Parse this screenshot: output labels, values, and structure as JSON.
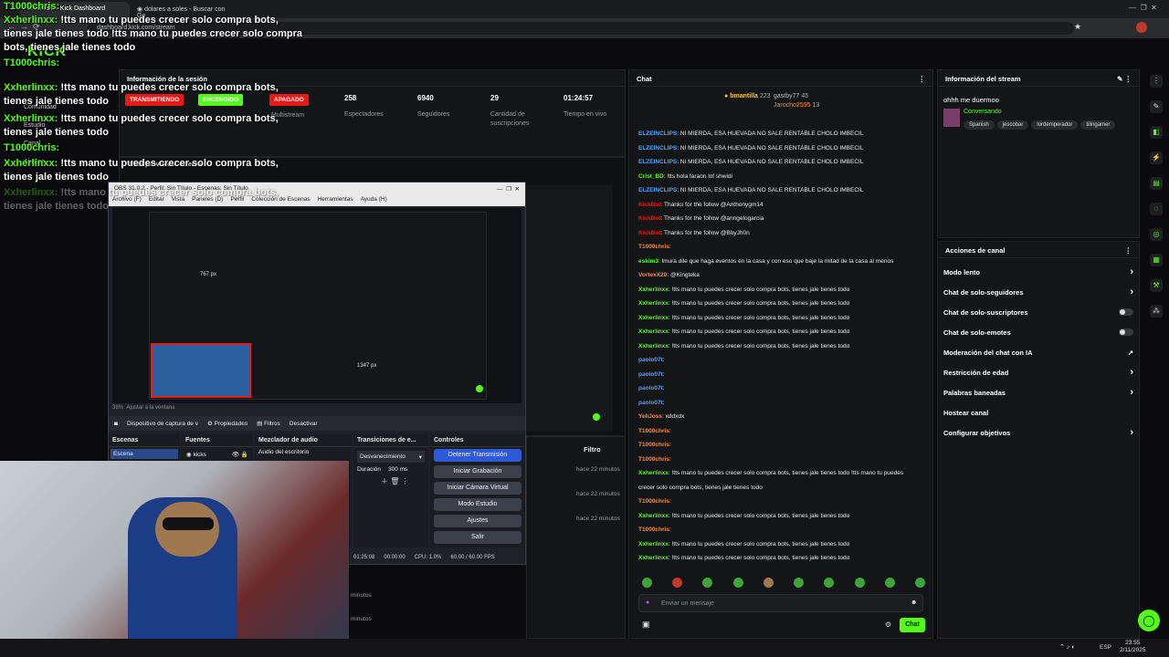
{
  "browser": {
    "tabs": [
      {
        "label": "Stream - Kick Dashboard"
      },
      {
        "label": "dolares a soles - Buscar con Go"
      }
    ],
    "url": "dashboard.kick.com/stream"
  },
  "colors": {
    "accent": "#53fc18",
    "live": "#e91916",
    "bg": "#0b0b0d",
    "panel": "#141517"
  },
  "kick": {
    "logo": "KICK"
  },
  "overlay": {
    "lines": [
      {
        "user": "T1000chris:",
        "text": ""
      },
      {
        "user": "Xxherlinxx:",
        "text": "!tts mano tu puedes crecer solo compra bots, tienes jale tienes todo !tts mano tu puedes crecer solo compra bots, tienes jale tienes todo"
      },
      {
        "user": "T1000chris:",
        "text": ""
      },
      {
        "user": "Xxherlinxx:",
        "text": "!tts mano tu puedes crecer solo compra bots, tienes jale tienes todo"
      },
      {
        "user": "Xxherlinxx:",
        "text": "!tts mano tu puedes crecer solo compra bots, tienes jale tienes todo"
      },
      {
        "user": "T1000chris:",
        "text": ""
      },
      {
        "user": "Xxherlinxx:",
        "text": "!tts mano tu puedes crecer solo compra bots, tienes jale tienes todo"
      },
      {
        "user": "Xxherlinxx:",
        "text": "!tts mano tu puedes crecer solo compra bots, tienes jale tienes todo"
      }
    ]
  },
  "sidebar": {
    "items": [
      "Stream",
      "Comunidad",
      "Estudio",
      "Canal",
      "Ajustes"
    ]
  },
  "session": {
    "title": "Información de la sesión",
    "badges": [
      "TRANSMITIENDO",
      "ENCENDIDO",
      "APAGADO"
    ],
    "multistream": "Multistream",
    "stats": [
      {
        "value": "258",
        "label": "Espectadores"
      },
      {
        "value": "6940",
        "label": "Seguidores"
      },
      {
        "value": "29",
        "label": "Cantidad de suscripciones"
      },
      {
        "value": "01:24:57",
        "label": "Tiempo en vivo"
      }
    ]
  },
  "preview": {
    "title": "Vista previa del stream"
  },
  "obs": {
    "title": "OBS 31.0.2 - Perfil: Sin Título - Escenas: Sin Título",
    "menu": [
      "Archivo (F)",
      "Editar",
      "Vista",
      "Paneles (D)",
      "Perfil",
      "Colección de Escenas",
      "Herramientas",
      "Ayuda (H)"
    ],
    "source_label": "Dispositivo de captura de v",
    "source_buttons": [
      "Propiedades",
      "Filtros",
      "Desactivar"
    ],
    "docks": [
      "Escenas",
      "Fuentes",
      "Mezclador de audio",
      "Transiciones de e...",
      "Controles"
    ],
    "scene": "Escena",
    "source": "kicks",
    "audio": "Audio del escritorio",
    "transition": "Desvanecimiento",
    "duration_label": "Duración",
    "duration_value": "300 ms",
    "controls": [
      "Detener Transmisión",
      "Iniciar Grabación",
      "Iniciar Cámara Virtual",
      "Modo Estudio",
      "Ajustes",
      "Salir"
    ],
    "status": {
      "time": "01:25:08",
      "rec": "00:00:00",
      "cpu": "CPU: 1.0%",
      "fps": "60.00 / 60.00 FPS"
    },
    "zoom": "38%",
    "fit": "Ajustar a la ventana",
    "dim1": "767 px",
    "dim2": "1347 px"
  },
  "activity": {
    "filter": "Filtro",
    "times": [
      "hace 22 minutos",
      "hace 22 minutos",
      "hace 22 minutos"
    ],
    "tail": [
      "minutos",
      "minutos",
      "minutos"
    ]
  },
  "chat": {
    "title": "Chat",
    "leaders": [
      {
        "name": "bmantilla",
        "count": "223"
      },
      {
        "name": "gastby77",
        "count": "45"
      },
      {
        "name": "Jarocho2595",
        "count": "13"
      }
    ],
    "messages": [
      {
        "user": "ELZEINCLIPS",
        "color": "#4aa3ff",
        "text": ": NI MIERDA, ESA HUEVADA NO SALE RENTABLE CHOLO IMBECIL"
      },
      {
        "user": "ELZEINCLIPS",
        "color": "#4aa3ff",
        "text": ": NI MIERDA, ESA HUEVADA NO SALE RENTABLE CHOLO IMBECIL"
      },
      {
        "user": "ELZEINCLIPS",
        "color": "#4aa3ff",
        "text": ": NI MIERDA, ESA HUEVADA NO SALE RENTABLE CHOLO IMBECIL"
      },
      {
        "user": "Crist_BD",
        "color": "#53fc18",
        "text": ": !tts hola faraon lof shwidi"
      },
      {
        "user": "ELZEINCLIPS",
        "color": "#4aa3ff",
        "text": ": NI MIERDA, ESA HUEVADA NO SALE RENTABLE CHOLO IMBECIL"
      },
      {
        "user": "KickBot",
        "color": "#e91916",
        "text": ": Thanks for the follow @Anthonygm14"
      },
      {
        "user": "KickBot",
        "color": "#e91916",
        "text": ": Thanks for the follow @anngelogarcia"
      },
      {
        "user": "KickBot",
        "color": "#e91916",
        "text": ": Thanks for the follow @BbyJh0n"
      },
      {
        "user": "T1000chris",
        "color": "#ff8a3d",
        "text": ":"
      },
      {
        "user": "eskim3",
        "color": "#53fc18",
        "text": ": lmura dile que haga eventos en la casa y con eso que baje la mitad de la casa al menos"
      },
      {
        "user": "VortexX20",
        "color": "#ff8a3d",
        "text": ": @Kingteka"
      },
      {
        "user": "Xxherlinxx",
        "color": "#53fc18",
        "text": ": !tts mano tu puedes crecer solo compra bots, tienes jale tienes todo"
      },
      {
        "user": "Xxherlinxx",
        "color": "#53fc18",
        "text": ": !tts mano tu puedes crecer solo compra bots, tienes jale tienes todo"
      },
      {
        "user": "Xxherlinxx",
        "color": "#53fc18",
        "text": ": !tts mano tu puedes crecer solo compra bots, tienes jale tienes todo"
      },
      {
        "user": "Xxherlinxx",
        "color": "#53fc18",
        "text": ": !tts mano tu puedes crecer solo compra bots, tienes jale tienes todo"
      },
      {
        "user": "Xxherlinxx",
        "color": "#53fc18",
        "text": ": !tts mano tu puedes crecer solo compra bots, tienes jale tienes todo"
      },
      {
        "user": "paolo07t",
        "color": "#4aa3ff",
        "text": ":"
      },
      {
        "user": "paolo07t",
        "color": "#4aa3ff",
        "text": ":"
      },
      {
        "user": "paolo07t",
        "color": "#4aa3ff",
        "text": ":"
      },
      {
        "user": "paolo07t",
        "color": "#4aa3ff",
        "text": ":"
      },
      {
        "user": "YeliJoss",
        "color": "#ff8a3d",
        "text": ": xddxdx"
      },
      {
        "user": "T1000chris",
        "color": "#ff8a3d",
        "text": ":"
      },
      {
        "user": "T1000chris",
        "color": "#ff8a3d",
        "text": ":"
      },
      {
        "user": "T1000chris",
        "color": "#ff8a3d",
        "text": ":"
      },
      {
        "user": "Xxherlinxx",
        "color": "#53fc18",
        "text": ": !tts mano tu puedes crecer solo compra bots, tienes jale tienes todo !tts mano tu puedes"
      },
      {
        "user": "",
        "color": "#e8e8e8",
        "text": "crecer solo compra bots, tienes jale tienes todo"
      },
      {
        "user": "T1000chris",
        "color": "#ff8a3d",
        "text": ":"
      },
      {
        "user": "Xxherlinxx",
        "color": "#53fc18",
        "text": ": !tts mano tu puedes crecer solo compra bots, tienes jale tienes todo"
      },
      {
        "user": "T1000chris",
        "color": "#ff8a3d",
        "text": ":"
      },
      {
        "user": "Xxherlinxx",
        "color": "#53fc18",
        "text": ": !tts mano tu puedes crecer solo compra bots, tienes jale tienes todo"
      },
      {
        "user": "Xxherlinxx",
        "color": "#53fc18",
        "text": ": !tts mano tu puedes crecer solo compra bots, tienes jale tienes todo"
      }
    ],
    "placeholder": "Enviar un mensaje",
    "send": "Chat"
  },
  "stream_info": {
    "title": "Información del stream",
    "stream_title": "ohhh me duermoo",
    "category": "Conversando",
    "tags": [
      "Spanish",
      "jescobar",
      "lordemperador",
      "tilingamer"
    ]
  },
  "actions": {
    "title": "Acciones de canal",
    "items": [
      {
        "label": "Modo lento",
        "type": "arrow"
      },
      {
        "label": "Chat de solo-seguidores",
        "type": "arrow"
      },
      {
        "label": "Chat de solo-suscriptores",
        "type": "toggle"
      },
      {
        "label": "Chat de solo-emotes",
        "type": "toggle"
      },
      {
        "label": "Moderación del chat con IA",
        "type": "link"
      },
      {
        "label": "Restricción de edad",
        "type": "arrow"
      },
      {
        "label": "Palabras baneadas",
        "type": "arrow"
      },
      {
        "label": "Hostear canal",
        "type": "none"
      },
      {
        "label": "Configurar objetivos",
        "type": "arrow"
      }
    ]
  },
  "taskbar": {
    "lang": "ESP",
    "time": "23:55",
    "date": "2/11/2025"
  }
}
